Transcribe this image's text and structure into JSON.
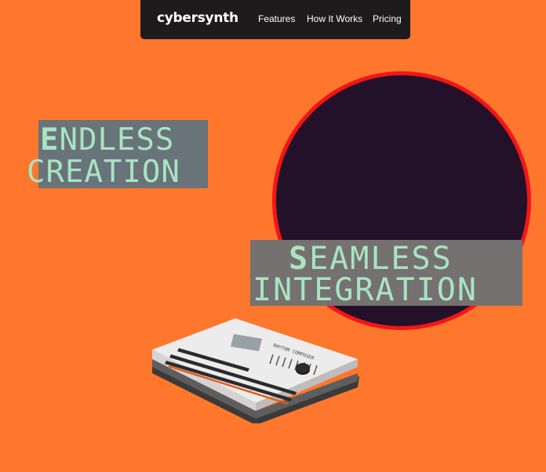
{
  "brand": {
    "logo_text": "cybersynth"
  },
  "nav": {
    "links": [
      {
        "label": "Features"
      },
      {
        "label": "How It Works"
      },
      {
        "label": "Pricing"
      }
    ]
  },
  "hero": {
    "endless": {
      "cap": "E",
      "line1_rest": "NDLESS",
      "line2": "CREATION"
    },
    "seamless": {
      "cap": "S",
      "line1_rest": "EAMLESS",
      "line2": "INTEGRATION"
    }
  },
  "product": {
    "panel_label": "RHYTHM COMPOSER",
    "icon": "drum-machine-illustration"
  },
  "colors": {
    "background": "#ff762d",
    "nav_bg": "#1d1b1c",
    "circle_fill": "#23112a",
    "circle_border": "#f21518",
    "headline_text": "#a8e4c1"
  }
}
